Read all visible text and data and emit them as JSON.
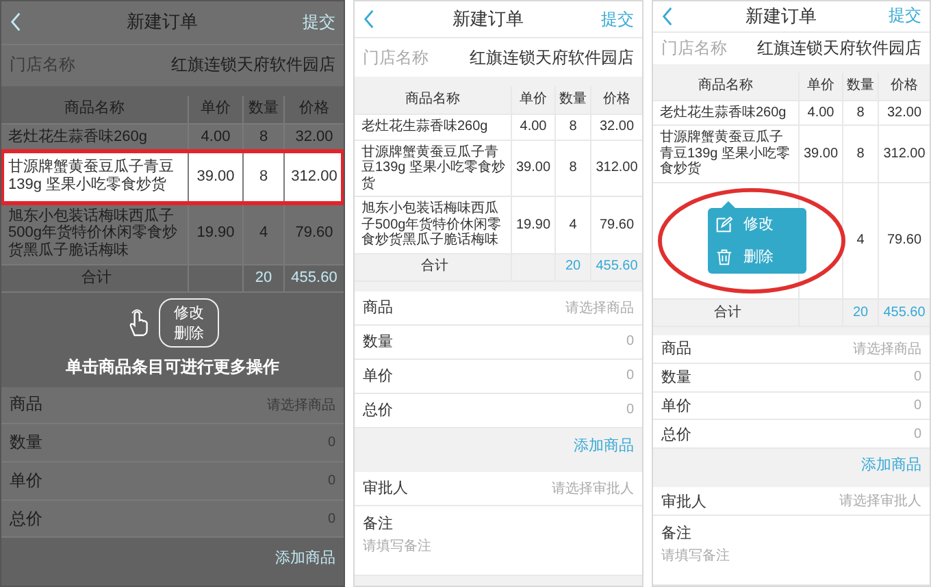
{
  "panels": [
    {
      "dimmed": true,
      "nav": {
        "title": "新建订单",
        "submit": "提交"
      },
      "store": {
        "label": "门店名称",
        "value": "红旗连锁天府软件园店"
      },
      "table": {
        "columns": [
          "商品名称",
          "单价",
          "数量",
          "价格"
        ],
        "rows": [
          {
            "name": "老灶花生蒜香味260g",
            "unit_price": "4.00",
            "qty": "8",
            "price": "32.00",
            "selected": false
          },
          {
            "name": "甘源牌蟹黄蚕豆瓜子青豆139g 坚果小吃零食炒货",
            "unit_price": "39.00",
            "qty": "8",
            "price": "312.00",
            "selected": true
          },
          {
            "name": "旭东小包装话梅味西瓜子500g年货特价休闲零食炒货黑瓜子脆话梅味",
            "unit_price": "19.90",
            "qty": "4",
            "price": "79.60",
            "selected": false
          }
        ],
        "total": {
          "label": "合计",
          "qty": "20",
          "price": "455.60"
        }
      },
      "callout": [
        "修改",
        "删除"
      ],
      "hint": "单击商品条目可进行更多操作",
      "fields": [
        {
          "kind": "select",
          "label": "商品",
          "placeholder": "请选择商品"
        },
        {
          "kind": "number",
          "label": "数量",
          "value": "0"
        },
        {
          "kind": "number",
          "label": "单价",
          "value": "0"
        },
        {
          "kind": "number",
          "label": "总价",
          "value": "0"
        }
      ],
      "add_button": "添加商品"
    },
    {
      "dimmed": false,
      "nav": {
        "title": "新建订单",
        "submit": "提交"
      },
      "store": {
        "label": "门店名称",
        "value": "红旗连锁天府软件园店"
      },
      "table": {
        "columns": [
          "商品名称",
          "单价",
          "数量",
          "价格"
        ],
        "rows": [
          {
            "name": "老灶花生蒜香味260g",
            "unit_price": "4.00",
            "qty": "8",
            "price": "32.00",
            "selected": false
          },
          {
            "name": "甘源牌蟹黄蚕豆瓜子青豆139g 坚果小吃零食炒货",
            "unit_price": "39.00",
            "qty": "8",
            "price": "312.00",
            "selected": false
          },
          {
            "name": "旭东小包装话梅味西瓜子500g年货特价休闲零食炒货黑瓜子脆话梅味",
            "unit_price": "19.90",
            "qty": "4",
            "price": "79.60",
            "selected": false
          }
        ],
        "total": {
          "label": "合计",
          "qty": "20",
          "price": "455.60"
        }
      },
      "fields": [
        {
          "kind": "select",
          "label": "商品",
          "placeholder": "请选择商品"
        },
        {
          "kind": "number",
          "label": "数量",
          "value": "0"
        },
        {
          "kind": "number",
          "label": "单价",
          "value": "0"
        },
        {
          "kind": "number",
          "label": "总价",
          "value": "0"
        }
      ],
      "add_button": "添加商品",
      "extra_fields": [
        {
          "kind": "select",
          "label": "审批人",
          "placeholder": "请选择审批人"
        },
        {
          "kind": "textarea",
          "label": "备注",
          "placeholder": "请填写备注"
        }
      ]
    },
    {
      "dimmed": false,
      "circled": true,
      "nav": {
        "title": "新建订单",
        "submit": "提交"
      },
      "store": {
        "label": "门店名称",
        "value": "红旗连锁天府软件园店"
      },
      "table": {
        "columns": [
          "商品名称",
          "单价",
          "数量",
          "价格"
        ],
        "rows": [
          {
            "name": "老灶花生蒜香味260g",
            "unit_price": "4.00",
            "qty": "8",
            "price": "32.00",
            "selected": false
          },
          {
            "name": "甘源牌蟹黄蚕豆瓜子青豆139g 坚果小吃零食炒货",
            "unit_price": "39.00",
            "qty": "8",
            "price": "312.00",
            "selected": false
          },
          {
            "qty": "4",
            "price": "79.60",
            "selected": false,
            "popup": [
              "修改",
              "删除"
            ]
          }
        ],
        "total": {
          "label": "合计",
          "qty": "20",
          "price": "455.60"
        }
      },
      "fields": [
        {
          "kind": "select",
          "label": "商品",
          "placeholder": "请选择商品"
        },
        {
          "kind": "number",
          "label": "数量",
          "value": "0"
        },
        {
          "kind": "number",
          "label": "单价",
          "value": "0"
        },
        {
          "kind": "number",
          "label": "总价",
          "value": "0"
        }
      ],
      "add_button": "添加商品",
      "extra_fields": [
        {
          "kind": "select",
          "label": "审批人",
          "placeholder": "请选择审批人"
        },
        {
          "kind": "textarea",
          "label": "备注",
          "placeholder": "请填写备注"
        }
      ]
    }
  ]
}
